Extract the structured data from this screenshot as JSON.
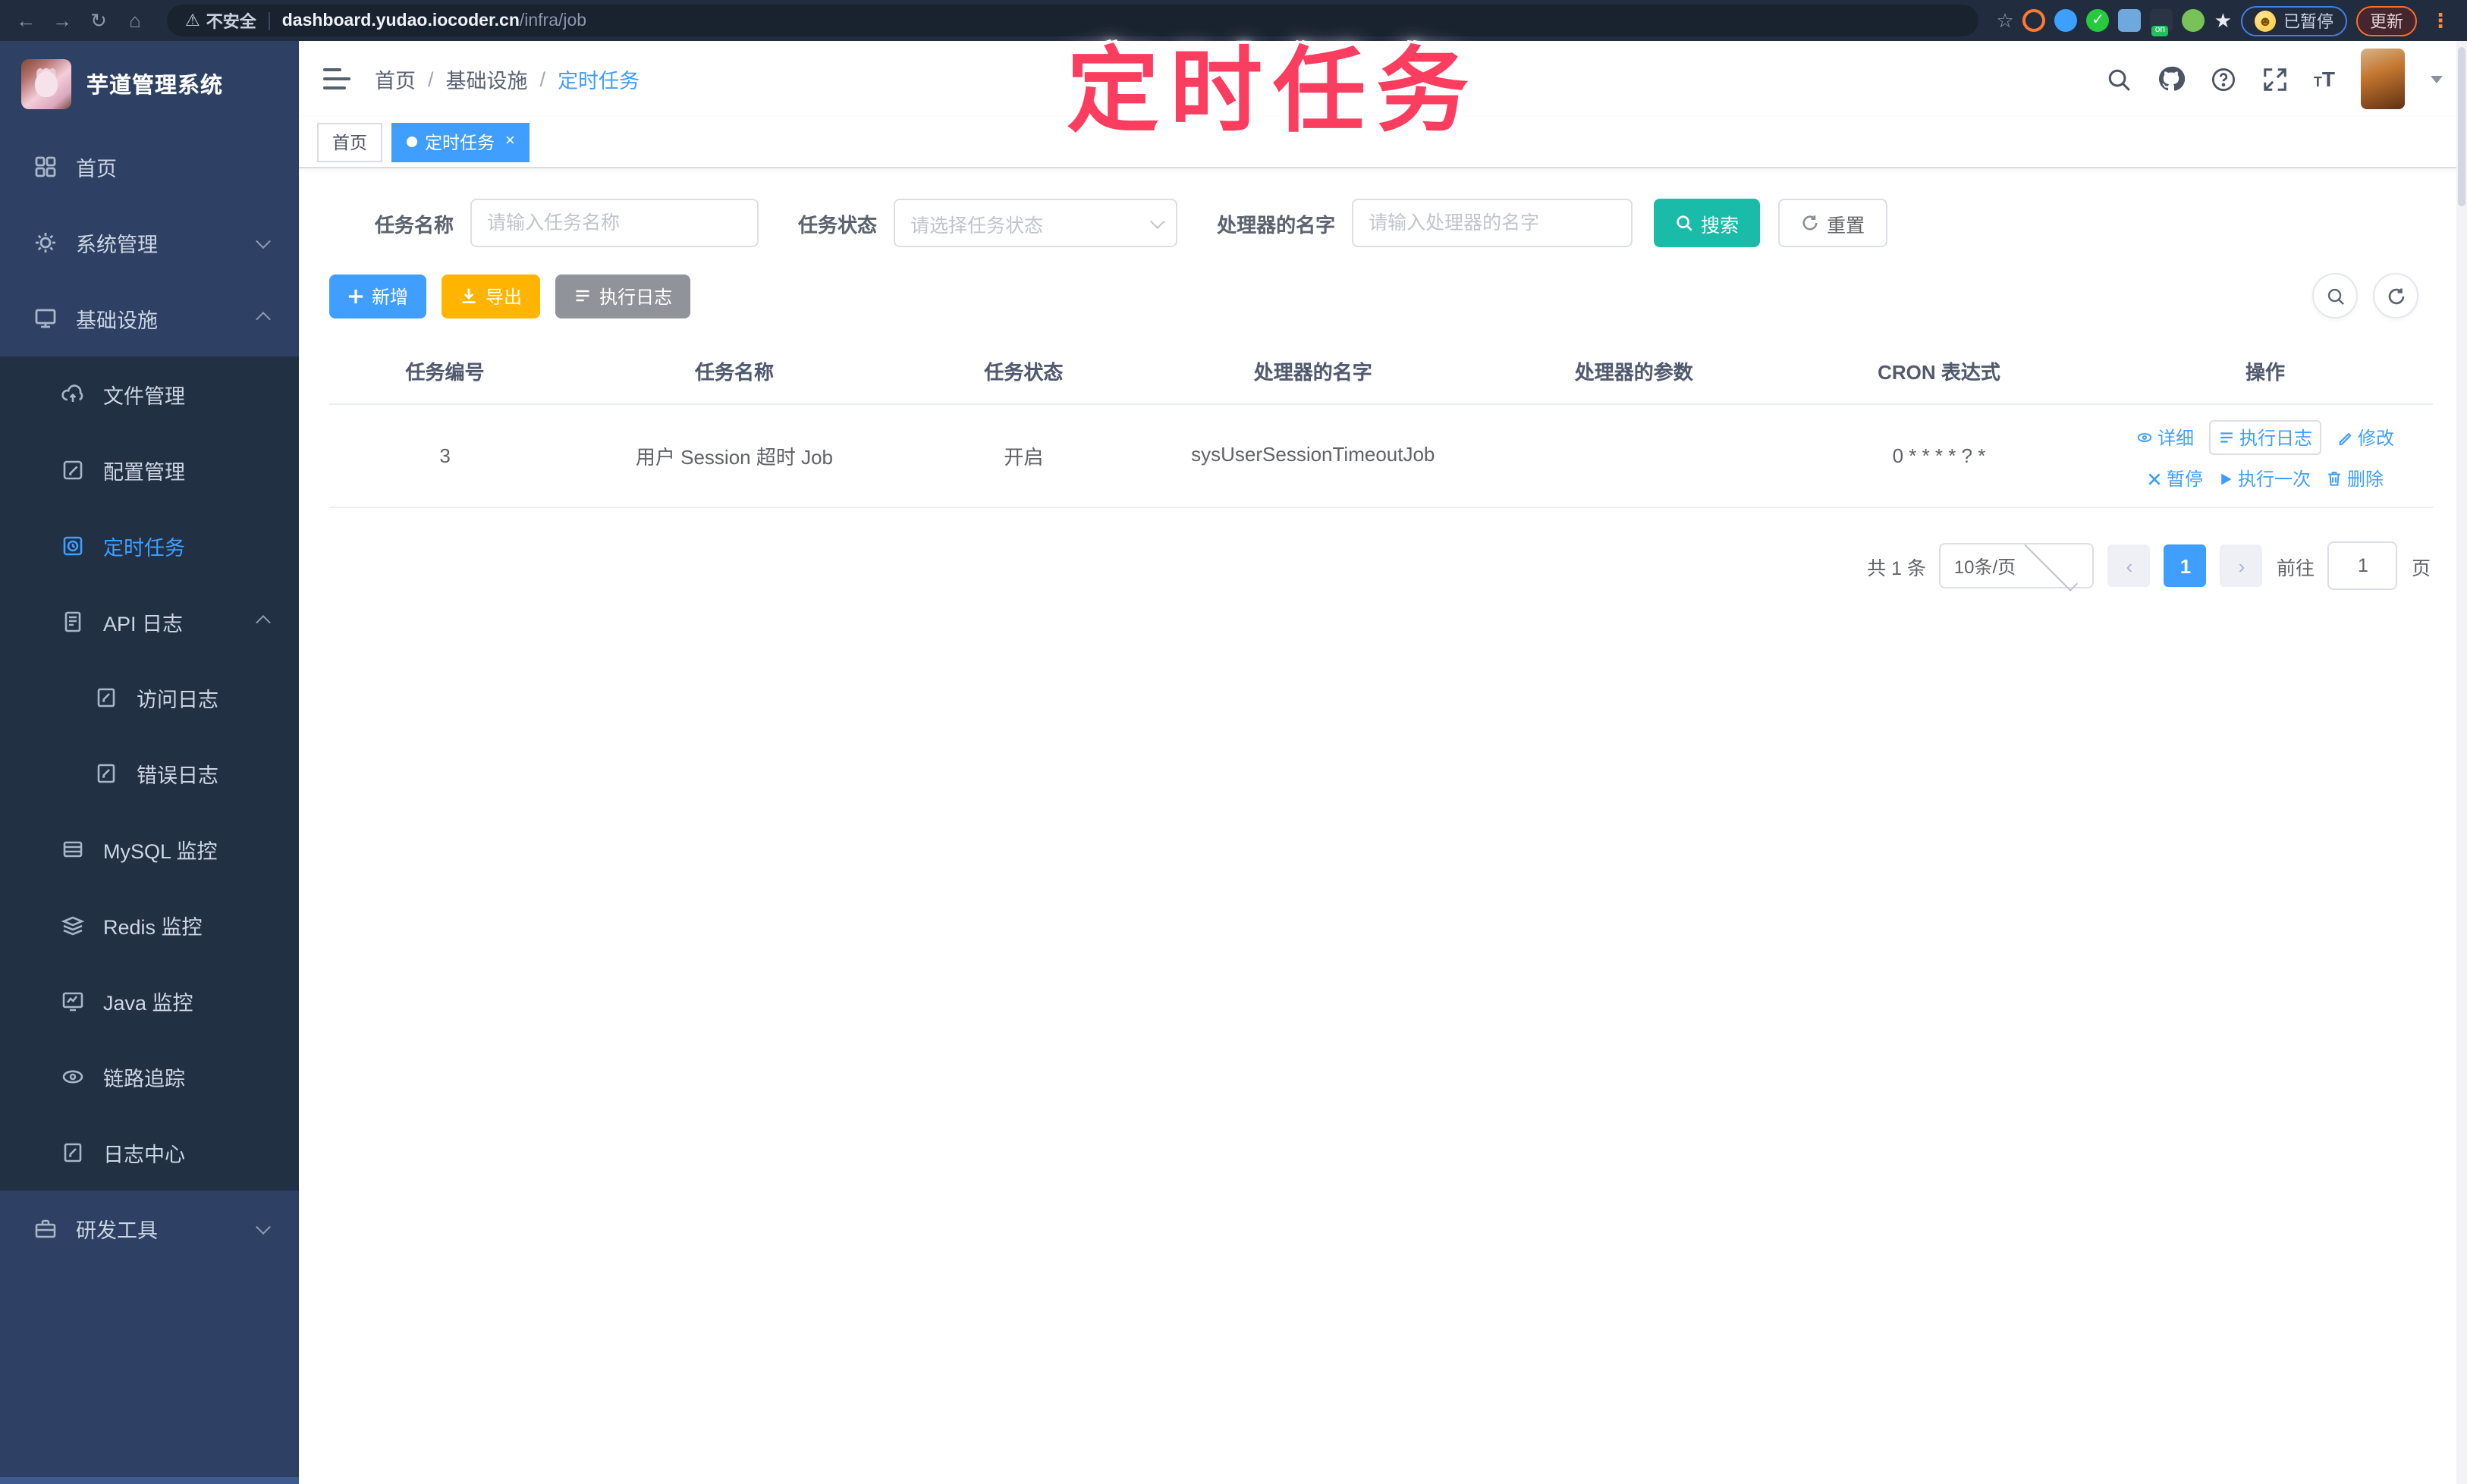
{
  "browser": {
    "security_label": "不安全",
    "url_host": "dashboard.yudao.iocoder.cn",
    "url_path": "/infra/job",
    "paused_badge": "已暂停",
    "update_button": "更新"
  },
  "watermark": "定时任务",
  "sidebar": {
    "app_title": "芋道管理系统",
    "items": [
      {
        "label": "首页",
        "icon": "home-icon",
        "level": 1
      },
      {
        "label": "系统管理",
        "icon": "gear-icon",
        "level": 1,
        "expand": "down"
      },
      {
        "label": "基础设施",
        "icon": "monitor-icon",
        "level": 1,
        "expand": "up"
      },
      {
        "label": "文件管理",
        "icon": "cloud-upload-icon",
        "level": 2
      },
      {
        "label": "配置管理",
        "icon": "edit-icon",
        "level": 2
      },
      {
        "label": "定时任务",
        "icon": "timer-icon",
        "level": 2,
        "active": true
      },
      {
        "label": "API 日志",
        "icon": "document-icon",
        "level": 2,
        "expand": "up"
      },
      {
        "label": "访问日志",
        "icon": "document-edit-icon",
        "level": 3
      },
      {
        "label": "错误日志",
        "icon": "document-edit-icon",
        "level": 3
      },
      {
        "label": "MySQL 监控",
        "icon": "database-icon",
        "level": 2
      },
      {
        "label": "Redis 监控",
        "icon": "layers-icon",
        "level": 2
      },
      {
        "label": "Java 监控",
        "icon": "screen-icon",
        "level": 2
      },
      {
        "label": "链路追踪",
        "icon": "eye-icon",
        "level": 2
      },
      {
        "label": "日志中心",
        "icon": "document-edit-icon",
        "level": 2
      },
      {
        "label": "研发工具",
        "icon": "briefcase-icon",
        "level": 1,
        "expand": "down"
      }
    ]
  },
  "header": {
    "breadcrumb": [
      "首页",
      "基础设施",
      "定时任务"
    ]
  },
  "tabs": [
    {
      "label": "首页",
      "active": false
    },
    {
      "label": "定时任务",
      "active": true,
      "closable": true
    }
  ],
  "filters": {
    "job_name_label": "任务名称",
    "job_name_placeholder": "请输入任务名称",
    "job_status_label": "任务状态",
    "job_status_placeholder": "请选择任务状态",
    "handler_label": "处理器的名字",
    "handler_placeholder": "请输入处理器的名字",
    "search_button": "搜索",
    "reset_button": "重置"
  },
  "toolbar": {
    "add_button": "新增",
    "export_button": "导出",
    "exec_log_button": "执行日志"
  },
  "table": {
    "columns": [
      "任务编号",
      "任务名称",
      "任务状态",
      "处理器的名字",
      "处理器的参数",
      "CRON 表达式",
      "操作"
    ],
    "rows": [
      {
        "id": "3",
        "name": "用户 Session 超时 Job",
        "status": "开启",
        "handler": "sysUserSessionTimeoutJob",
        "param": "",
        "cron": "0 * * * * ? *",
        "ops": [
          "详细",
          "执行日志",
          "修改",
          "暂停",
          "执行一次",
          "删除"
        ]
      }
    ]
  },
  "pagination": {
    "total": "共 1 条",
    "page_size": "10条/页",
    "prev": "‹",
    "page": "1",
    "next": "›",
    "goto_label": "前往",
    "goto_value": "1",
    "goto_suffix": "页"
  },
  "colors": {
    "accent": "#409eff",
    "search_button": "#1abca9",
    "export_button": "#ffb400",
    "info_button": "#909399",
    "sidebar_bg": "#2e4164",
    "submenu_bg": "#223044",
    "watermark": "#fb3d60"
  }
}
